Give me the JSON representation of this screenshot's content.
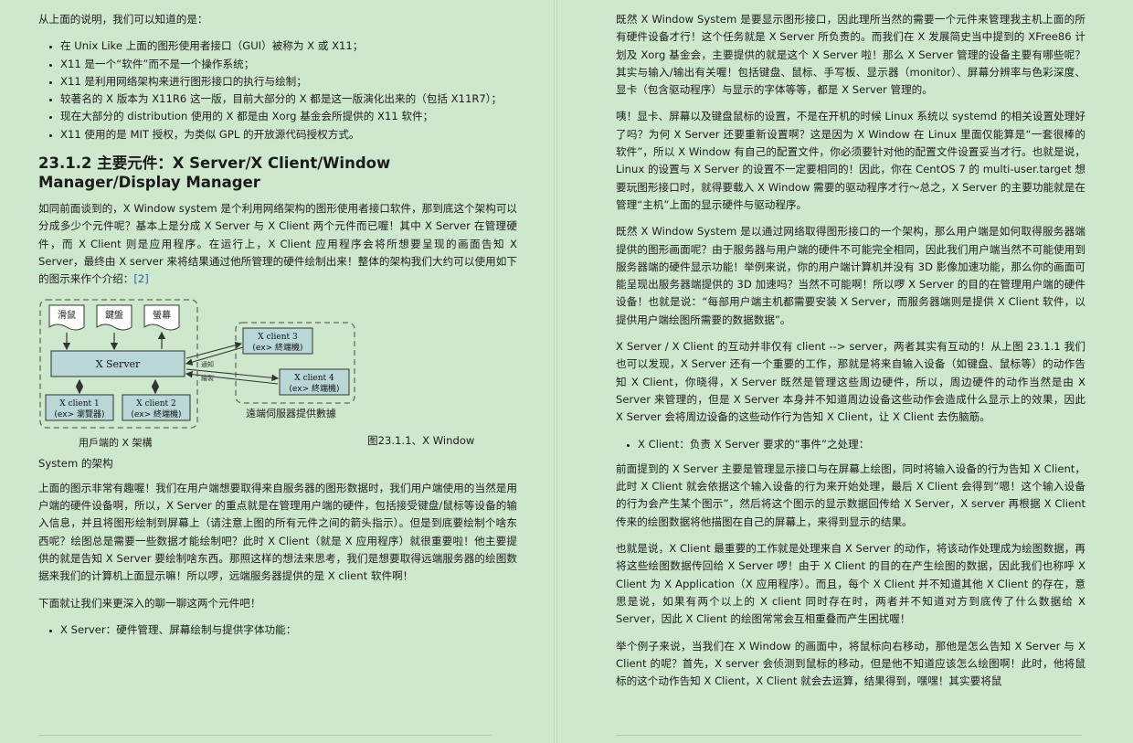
{
  "left": {
    "intro": "从上面的说明，我们可以知道的是：",
    "bullets": [
      "在 Unix Like 上面的图形使用者接口（GUI）被称为 X 或 X11；",
      "X11 是一个“软件”而不是一个操作系统；",
      "X11 是利用网络架构来进行图形接口的执行与绘制；",
      "较著名的 X 版本为 X11R6 这一版，目前大部分的 X 都是这一版演化出来的（包括 X11R7）；",
      "现在大部分的 distribution 使用的 X 都是由 Xorg 基金会所提供的 X11 软件；",
      "X11 使用的是 MIT 授权，为类似 GPL 的开放源代码授权方式。"
    ],
    "heading": "23.1.2 主要元件：X Server/X Client/Window Manager/Display Manager",
    "para1": "如同前面谈到的，X Window system 是个利用网络架构的图形使用者接口软件，那到底这个架构可以分成多少个元件呢？基本上是分成 X Server 与 X Client 两个元件而已喔！其中 X Server 在管理硬件，而 X Client 则是应用程序。在运行上，X Client 应用程序会将所想要呈现的画面告知 X Server，最终由 X server 来将结果通过他所管理的硬件绘制出来！整体的架构我们大约可以使用如下的图示来作个介绍：",
    "para1_link": "[2]",
    "figure": {
      "device_mouse": "滑鼠",
      "device_keyboard": "鍵盤",
      "device_screen": "螢幕",
      "server": "X Server",
      "client1_line1": "X client 1",
      "client1_line2": "(ex> 瀏覽器)",
      "client2_line1": "X client 2",
      "client2_line2": "(ex> 終端機)",
      "client3_line1": "X client 3",
      "client3_line2": "(ex> 終端機)",
      "client4_line1": "X client 4",
      "client4_line2": "(ex> 終端機)",
      "arrow_label1": "通知",
      "arrow_label2": "繪製",
      "user_side": "用戶端的 X 架構",
      "remote_side": "遠端伺服器提供數據"
    },
    "figure_caption": "图23.1.1、X Window",
    "figure_caption2": "System 的架构",
    "para2": "上面的图示非常有趣喔！我们在用户端想要取得来自服务器的图形数据时，我们用户端使用的当然是用户端的硬件设备啊，所以，X Server 的重点就是在管理用户端的硬件，包括接受键盘/鼠标等设备的输入信息，并且将图形绘制到屏幕上（请注意上图的所有元件之间的箭头指示）。但是到底要绘制个啥东西呢？绘图总是需要一些数据才能绘制吧？此时 X Client（就是 X 应用程序）就很重要啦！他主要提供的就是告知 X Server 要绘制啥东西。那照这样的想法来思考，我们是想要取得远端服务器的绘图数据来我们的计算机上面显示嘛！所以啰，远端服务器提供的是 X client 软件啊！",
    "para3": "下面就让我们来更深入的聊一聊这两个元件吧！",
    "bullet_last": "X Server：硬件管理、屏幕绘制与提供字体功能："
  },
  "right": {
    "para1": "既然 X Window System 是要显示图形接口，因此理所当然的需要一个元件来管理我主机上面的所有硬件设备才行！这个任务就是 X Server 所负责的。而我们在 X 发展简史当中提到的 XFree86 计划及 Xorg 基金会，主要提供的就是这个 X Server 啦！那么 X Server 管理的设备主要有哪些呢？其实与输入/输出有关喔！包括键盘、鼠标、手写板、显示器（monitor）、屏幕分辨率与色彩深度、显卡（包含驱动程序）与显示的字体等等，都是 X Server 管理的。",
    "para2": "咦！显卡、屏幕以及键盘鼠标的设置，不是在开机的时候 Linux 系统以 systemd 的相关设置处理好了吗？为何 X Server 还要重新设置啊？这是因为 X Window 在 Linux 里面仅能算是“一套很棒的软件”，所以 X Window 有自己的配置文件，你必须要针对他的配置文件设置妥当才行。也就是说，Linux 的设置与 X Server 的设置不一定要相同的！因此，你在 CentOS 7 的 multi-user.target 想要玩图形接口时，就得要载入 X Window 需要的驱动程序才行～总之，X Server 的主要功能就是在管理“主机”上面的显示硬件与驱动程序。",
    "para3": "既然 X Window System 是以通过网络取得图形接口的一个架构，那么用户端是如何取得服务器端提供的图形画面呢？由于服务器与用户端的硬件不可能完全相同，因此我们用户端当然不可能使用到服务器端的硬件显示功能！举例来说，你的用户端计算机并没有 3D 影像加速功能，那么你的画面可能呈现出服务器端提供的 3D 加速吗？当然不可能啊！所以啰 X Server 的目的在管理用户端的硬件设备！也就是说：“每部用户端主机都需要安装 X Server，而服务器端则是提供 X Client 软件，以提供用户端绘图所需要的数据数据”。",
    "para4": "X Server / X Client 的互动并非仅有 client --> server，两者其实有互动的！从上图 23.1.1 我们也可以发现，X Server 还有一个重要的工作，那就是将来自输入设备（如键盘、鼠标等）的动作告知 X Client，你晓得，X Server 既然是管理这些周边硬件，所以，周边硬件的动作当然是由 X Server 来管理的，但是 X Server 本身并不知道周边设备这些动作会造成什么显示上的效果，因此 X Server 会将周边设备的这些动作行为告知 X Client，让 X Client 去伤脑筋。",
    "bullet": "X Client：负责 X Server 要求的“事件”之处理：",
    "para5": "前面提到的 X Server 主要是管理显示接口与在屏幕上绘图，同时将输入设备的行为告知 X Client，此时 X Client 就会依据这个输入设备的行为来开始处理，最后 X Client 会得到“嗯！这个输入设备的行为会产生某个图示”，然后将这个图示的显示数据回传给 X Server，X server 再根据 X Client 传来的绘图数据将他描图在自己的屏幕上，来得到显示的结果。",
    "para6": "也就是说，X Client 最重要的工作就是处理来自 X Server 的动作，将该动作处理成为绘图数据，再将这些绘图数据传回给 X Server 啰！由于 X Client 的目的在产生绘图的数据，因此我们也称呼 X Client 为 X Application（X 应用程序）。而且，每个 X Client 并不知道其他 X Client 的存在，意思是说，如果有两个以上的 X client 同时存在时，两者并不知道对方到底传了什么数据给 X Server，因此 X Client 的绘图常常会互相重叠而产生困扰喔！",
    "para7": "举个例子来说，当我们在 X Window 的画面中，将鼠标向右移动，那他是怎么告知 X Server 与 X Client 的呢？首先，X server 会侦测到鼠标的移动，但是他不知道应该怎么绘图啊！此时，他将鼠标的这个动作告知 X Client，X Client 就会去运算，结果得到，嘿嘿！其实要将鼠"
  }
}
